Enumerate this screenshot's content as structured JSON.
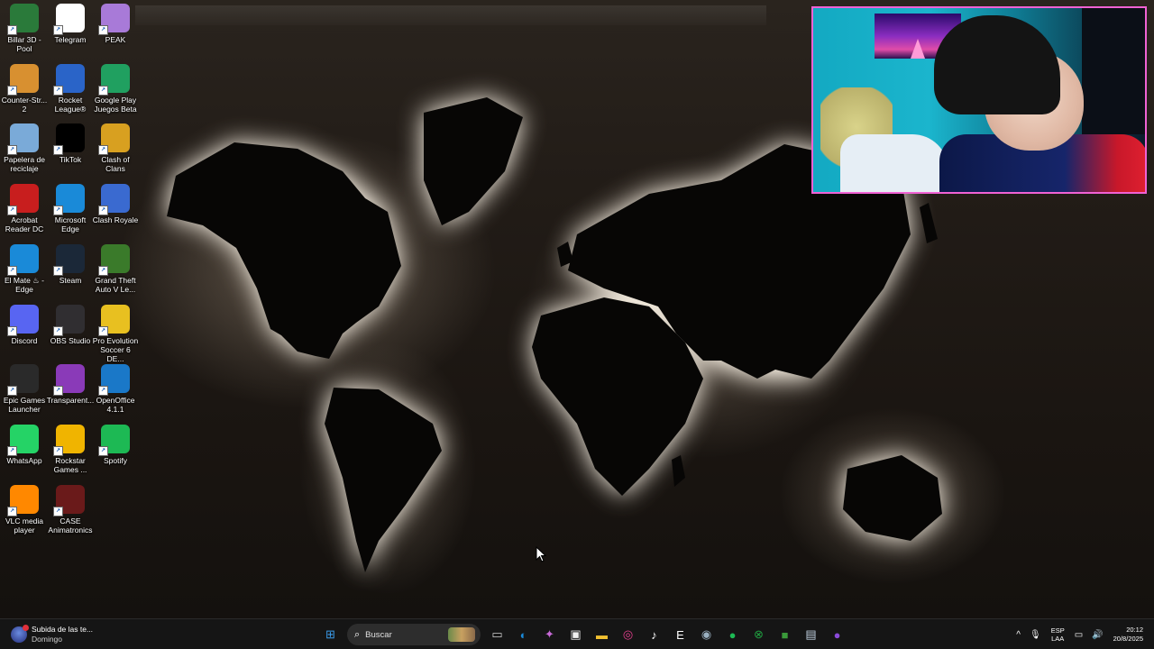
{
  "desktop": {
    "icons": [
      {
        "label": "Billar 3D - Pool",
        "icon": "billiards-icon",
        "color": "#2a7a3a"
      },
      {
        "label": "Telegram",
        "icon": "blank-file-icon",
        "color": "#ffffff"
      },
      {
        "label": "PEAK",
        "icon": "peak-mountain-icon",
        "color": "#a87ad8"
      },
      {
        "label": "Counter-Str... 2",
        "icon": "counter-strike-icon",
        "color": "#d89030"
      },
      {
        "label": "Rocket League®",
        "icon": "rocket-league-icon",
        "color": "#2a64c8"
      },
      {
        "label": "Google Play Juegos Beta",
        "icon": "google-play-games-icon",
        "color": "#20a060"
      },
      {
        "label": "Papelera de reciclaje",
        "icon": "recycle-bin-icon",
        "color": "#7aaad8"
      },
      {
        "label": "TikTok",
        "icon": "tiktok-icon",
        "color": "#000000"
      },
      {
        "label": "Clash of Clans",
        "icon": "clash-of-clans-icon",
        "color": "#d8a020"
      },
      {
        "label": "Acrobat Reader DC",
        "icon": "acrobat-icon",
        "color": "#c81e1e"
      },
      {
        "label": "Microsoft Edge",
        "icon": "edge-icon",
        "color": "#1a8ad8"
      },
      {
        "label": "Clash Royale",
        "icon": "clash-royale-icon",
        "color": "#3a6ad0"
      },
      {
        "label": "El Mate ♨ - Edge",
        "icon": "edge-icon",
        "color": "#1a8ad8"
      },
      {
        "label": "Steam",
        "icon": "steam-icon",
        "color": "#1b2838"
      },
      {
        "label": "Grand Theft Auto V Le...",
        "icon": "gta-v-icon",
        "color": "#3a7a2a"
      },
      {
        "label": "Discord",
        "icon": "discord-icon",
        "color": "#5865f2"
      },
      {
        "label": "OBS Studio",
        "icon": "obs-icon",
        "color": "#302e31"
      },
      {
        "label": "Pro Evolution Soccer 6 DE...",
        "icon": "pes6-icon",
        "color": "#e8c020"
      },
      {
        "label": "Epic Games Launcher",
        "icon": "epic-games-icon",
        "color": "#2a2a2a"
      },
      {
        "label": "Transparent...",
        "icon": "transparent-icon",
        "color": "#8a3ab8"
      },
      {
        "label": "OpenOffice 4.1.1",
        "icon": "openoffice-icon",
        "color": "#1a78c8"
      },
      {
        "label": "WhatsApp",
        "icon": "whatsapp-icon",
        "color": "#25d366"
      },
      {
        "label": "Rockstar Games ...",
        "icon": "rockstar-icon",
        "color": "#f0b400"
      },
      {
        "label": "Spotify",
        "icon": "spotify-icon",
        "color": "#1db954"
      },
      {
        "label": "VLC media player",
        "icon": "vlc-icon",
        "color": "#ff8800"
      },
      {
        "label": "CASE Animatronics",
        "icon": "case-animatronics-icon",
        "color": "#6a1a1a"
      }
    ]
  },
  "taskbar": {
    "widget": {
      "title": "Subida de las te...",
      "subtitle": "Domingo",
      "icon": "weather-widget-icon"
    },
    "search_placeholder": "Buscar",
    "pinned": [
      {
        "name": "start",
        "icon": "windows-start-icon",
        "glyph": "⊞",
        "color": "#3a9ae8"
      },
      {
        "name": "search",
        "icon": "search-icon"
      },
      {
        "name": "task-view",
        "icon": "task-view-icon",
        "glyph": "▭",
        "color": "#d0d0d0"
      },
      {
        "name": "edge",
        "icon": "edge-icon",
        "glyph": "◐",
        "color": "#1a8ad8"
      },
      {
        "name": "copilot",
        "icon": "copilot-icon",
        "glyph": "✦",
        "color": "#c86ad8"
      },
      {
        "name": "store",
        "icon": "store-icon",
        "glyph": "▣",
        "color": "#f0f0f0"
      },
      {
        "name": "file-explorer",
        "icon": "folder-icon",
        "glyph": "▬",
        "color": "#f0c030"
      },
      {
        "name": "instagram",
        "icon": "instagram-icon",
        "glyph": "◎",
        "color": "#e84090"
      },
      {
        "name": "tiktok",
        "icon": "tiktok-icon",
        "glyph": "♪",
        "color": "#ffffff"
      },
      {
        "name": "epic-games",
        "icon": "epic-games-icon",
        "glyph": "E",
        "color": "#ffffff"
      },
      {
        "name": "chrome",
        "icon": "chrome-icon",
        "glyph": "◉",
        "color": "#9ab0c0"
      },
      {
        "name": "spotify",
        "icon": "spotify-icon",
        "glyph": "●",
        "color": "#1db954"
      },
      {
        "name": "xbox",
        "icon": "xbox-icon",
        "glyph": "⊗",
        "color": "#20a040"
      },
      {
        "name": "minecraft",
        "icon": "minecraft-icon",
        "glyph": "■",
        "color": "#3a9a3a"
      },
      {
        "name": "snipping",
        "icon": "snipping-tool-icon",
        "glyph": "▤",
        "color": "#c0d0e0"
      },
      {
        "name": "transparent",
        "icon": "transparent-app-icon",
        "glyph": "●",
        "color": "#8a4ad8"
      }
    ],
    "tray": {
      "chevron": "^",
      "lang_top": "ESP",
      "lang_bottom": "LAA",
      "time": "20:12",
      "date": "20/8/2025"
    }
  },
  "webcam": {
    "border_color": "#f062d4"
  }
}
